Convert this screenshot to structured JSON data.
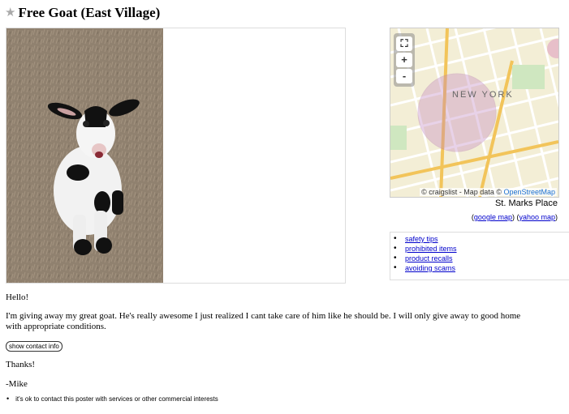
{
  "header": {
    "title": "Free Goat (East Village)",
    "star_icon": "star-icon"
  },
  "map": {
    "zoom_full": "⛶",
    "zoom_in": "+",
    "zoom_out": "-",
    "city_label": "NEW YORK",
    "attribution_prefix": "© craigslist - Map data © ",
    "attribution_link": "OpenStreetMap",
    "address": "St. Marks Place",
    "google_link": "google map",
    "yahoo_link": "yahoo map"
  },
  "tips": {
    "items": [
      "safety tips",
      "prohibited items",
      "product recalls",
      "avoiding scams"
    ]
  },
  "posting": {
    "greeting": "Hello!",
    "body": "I'm giving away my great goat. He's really awesome I just realized I cant take care of him like he should be. I will only give away to good home with appropriate conditions.",
    "contact_button": "show contact info",
    "thanks": "Thanks!",
    "signature": "-Mike",
    "notice": "it's ok to contact this poster with services or other commercial interests"
  },
  "colors": {
    "link": "#0000cc",
    "map_circle": "#c080c0",
    "map_bg": "#f3eed6"
  }
}
